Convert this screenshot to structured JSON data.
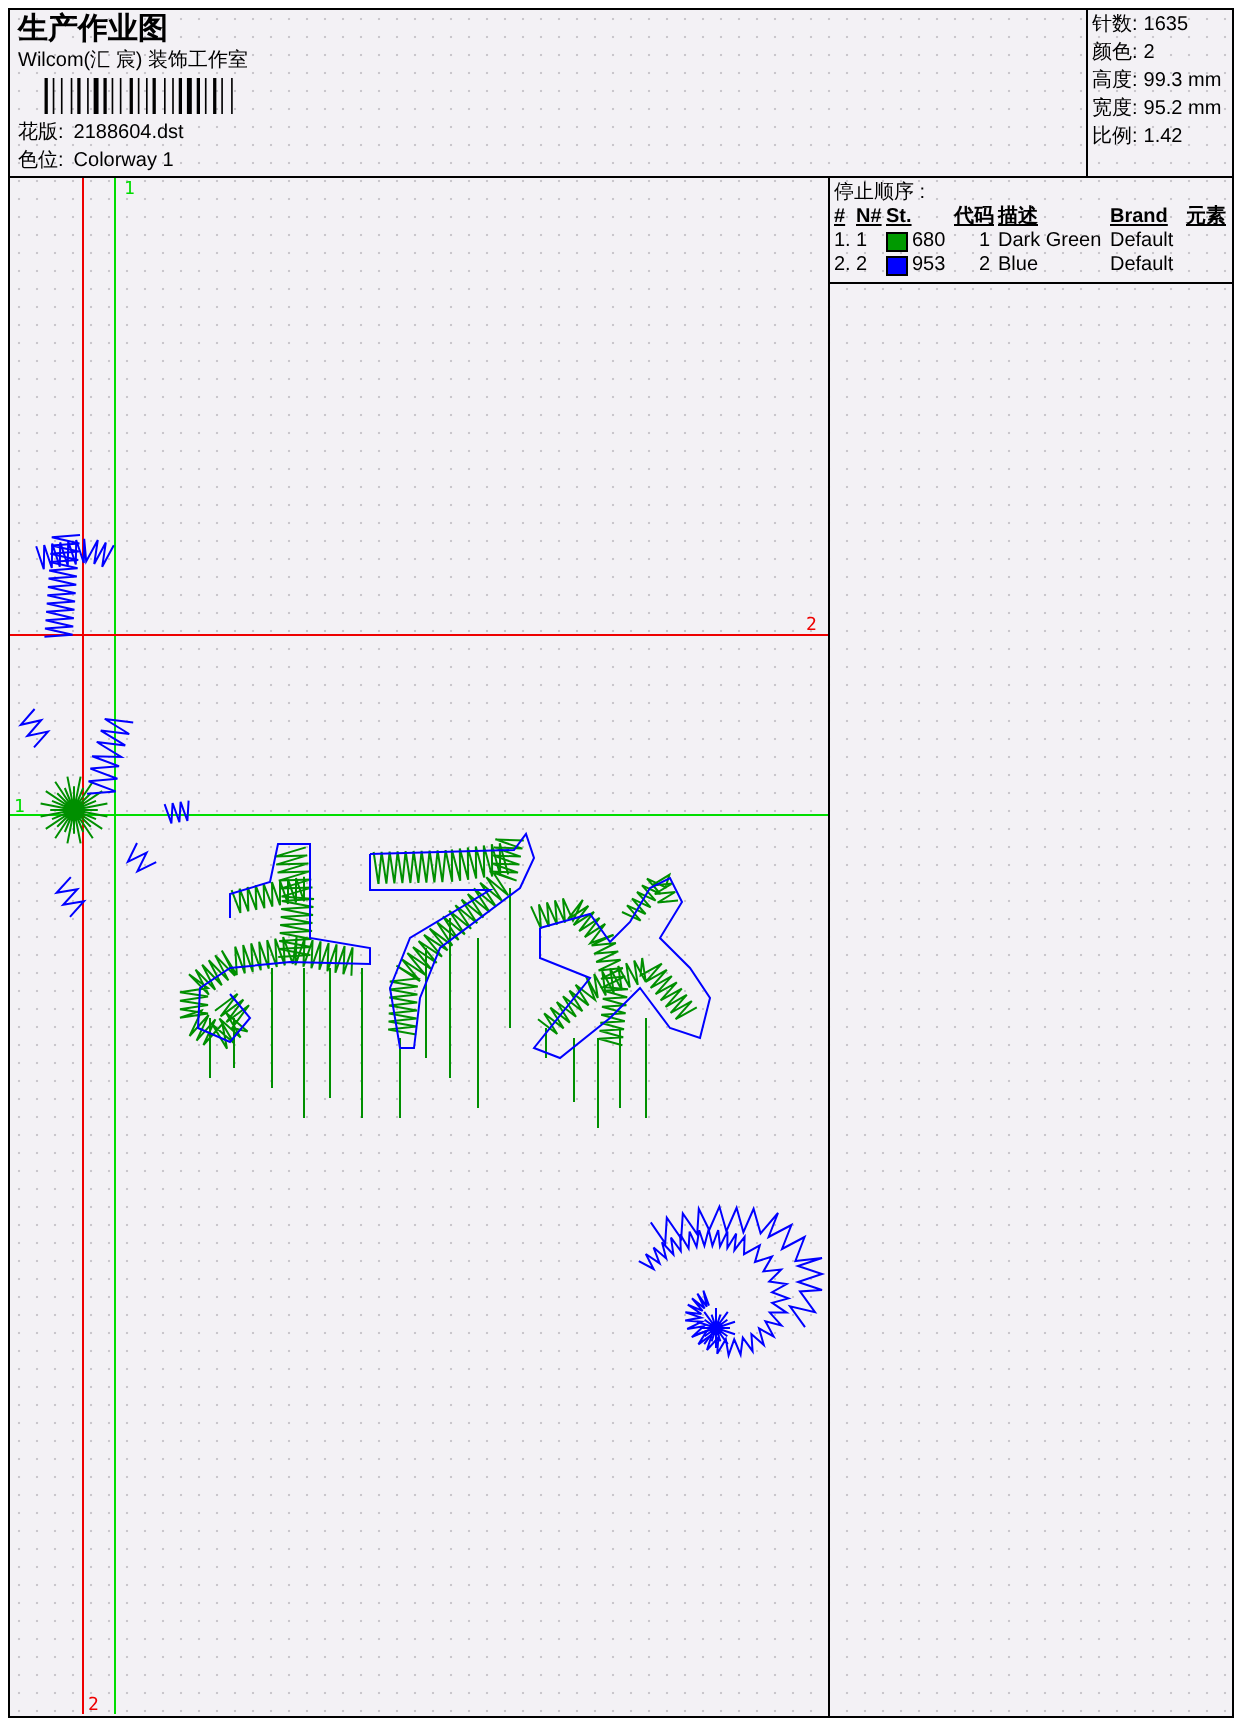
{
  "header": {
    "title": "生产作业图",
    "company": "Wilcom(汇 宸) 装饰工作室",
    "design": {
      "label": "花版:",
      "value": "2188604.dst"
    },
    "colorway": {
      "label": "色位:",
      "value": "Colorway 1"
    }
  },
  "stats": [
    {
      "label": "针数:",
      "value": "1635"
    },
    {
      "label": "颜色:",
      "value": "2"
    },
    {
      "label": "高度:",
      "value": "99.3 mm"
    },
    {
      "label": "宽度:",
      "value": "95.2 mm"
    },
    {
      "label": "比例:",
      "value": "1.42"
    }
  ],
  "stop_sequence": {
    "title": "停止顺序 :",
    "columns": [
      "#",
      "N#",
      "St.",
      "代码",
      "描述",
      "Brand",
      "元素"
    ],
    "rows": [
      {
        "index": "1.",
        "n": "1",
        "color": "#009900",
        "stitches": "680",
        "code": "1",
        "description": "Dark Green",
        "brand": "Default"
      },
      {
        "index": "2.",
        "n": "2",
        "color": "#0000ff",
        "stitches": "953",
        "code": "2",
        "description": "Blue",
        "brand": "Default"
      }
    ]
  },
  "canvas": {
    "markers": [
      {
        "color": "#00dd00",
        "vertical_label": "1",
        "horizontal_label": "1"
      },
      {
        "color": "#ee0000",
        "vertical_label": "2",
        "horizontal_label": "2"
      }
    ]
  }
}
